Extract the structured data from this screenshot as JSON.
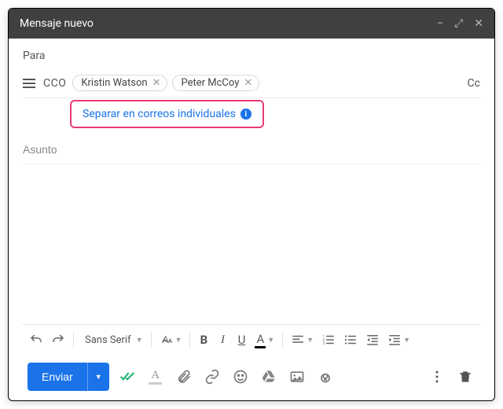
{
  "window": {
    "title": "Mensaje nuevo",
    "controls": {
      "minimize": "−",
      "expand": "⤢",
      "close": "✕"
    }
  },
  "to": {
    "label": "Para"
  },
  "recipients": {
    "menu_name": "bulk-options",
    "field_label": "CCO",
    "chips": [
      "Kristin Watson",
      "Peter McCoy"
    ],
    "cc_label": "Cc"
  },
  "split_link": {
    "text": "Separar en correos individuales",
    "info": "i"
  },
  "subject": {
    "placeholder": "Asunto",
    "value": ""
  },
  "toolbar": {
    "font_name": "Sans Serif",
    "bold": "B",
    "italic": "I",
    "underline": "U",
    "text_A": "A"
  },
  "bottom": {
    "send": "Enviar"
  }
}
